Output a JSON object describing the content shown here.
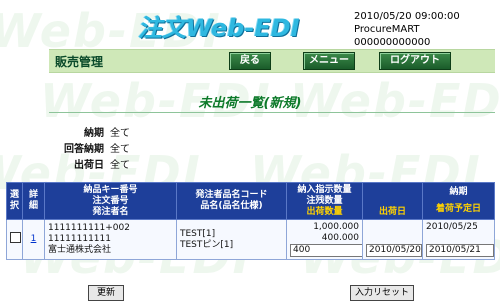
{
  "watermark": "Web-EDI",
  "app_title": "注文Web-EDI",
  "system_info": {
    "datetime": "2010/05/20 09:00:00",
    "company": "ProcureMART",
    "code": "000000000000"
  },
  "nav": {
    "section_title": "販売管理",
    "back_label": "戻る",
    "menu_label": "メニュー",
    "logout_label": "ログアウト"
  },
  "page_heading": "未出荷一覧(新規)",
  "filters": [
    {
      "label": "納期",
      "value": "全て"
    },
    {
      "label": "回答納期",
      "value": "全て"
    },
    {
      "label": "出荷日",
      "value": "全て"
    }
  ],
  "table": {
    "headers": {
      "select": "選択",
      "detail": "詳細",
      "ids": [
        "納品キー番号",
        "注文番号",
        "発注者名"
      ],
      "item": [
        "発注者品名コード",
        "品名(品名仕様)"
      ],
      "qty": [
        "納入指示数量",
        "注残数量"
      ],
      "qty_highlight": "出荷数量",
      "ship_date": "出荷日",
      "delivery": "納期",
      "delivery_highlight": "着荷予定日"
    },
    "rows": [
      {
        "detail_link": "1",
        "key_no": "1111111111+002",
        "order_no": "11111111111",
        "orderer": "富士通株式会社",
        "item_code": "TEST[1]",
        "item_name": "TESTピン[1]",
        "instruct_qty": "1,000.000",
        "remain_qty": "400.000",
        "ship_qty_input": "400",
        "ship_date_input": "2010/05/20",
        "delivery": "2010/05/25",
        "arrival_input": "2010/05/21"
      }
    ]
  },
  "buttons": {
    "update": "更新",
    "reset": "入力リセット"
  }
}
